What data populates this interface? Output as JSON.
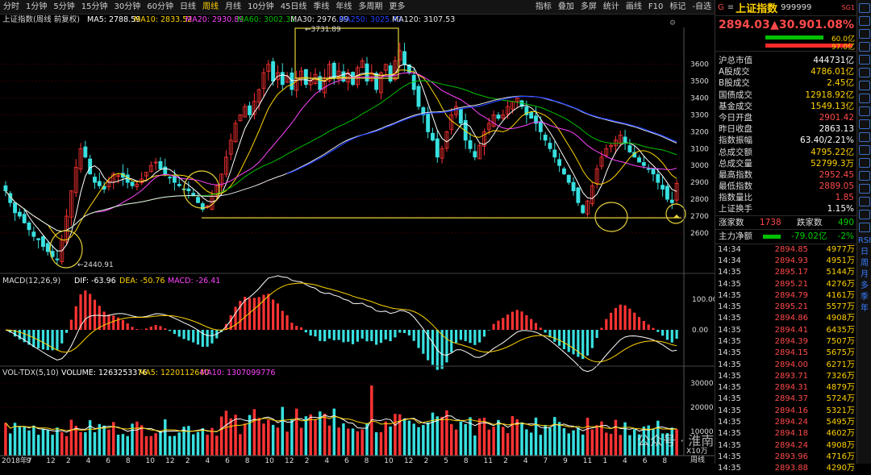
{
  "toolbar": {
    "periods": [
      "分时",
      "1分钟",
      "5分钟",
      "15分钟",
      "30分钟",
      "60分钟",
      "日线",
      "周线",
      "月线",
      "10分钟",
      "45日线",
      "季线",
      "年线",
      "多周期",
      "更多"
    ],
    "active_period": "周线",
    "right_tools": [
      "指标",
      "叠加",
      "多屏",
      "统计",
      "画线",
      "F10",
      "标记",
      "-自选"
    ]
  },
  "chart_header": {
    "name": "上证指数(周线 前复权)",
    "ma5": "MA5: 2788.59",
    "ma10": "MA10: 2833.52",
    "ma20": "MA20: 2930.89",
    "ma60": "MA60: 3002.31",
    "ma30": "MA30: 2976.99",
    "ma250": "MA250: 3025.43",
    "ma120": "MA120: 3107.53"
  },
  "colors": {
    "up": "#ff3333",
    "down": "#38e0e0",
    "ma5": "#ffffff",
    "ma10": "#ffd400",
    "ma20": "#ff44ff",
    "ma60": "#00c000",
    "ma120": "#e8e8e8",
    "ma250": "#2040ff",
    "annot": "#e6d23a",
    "grid": "#8a0000"
  },
  "chart_data": {
    "type": "candlestick",
    "price_axis": {
      "ticks": [
        3600,
        3500,
        3400,
        3300,
        3200,
        3100,
        3000,
        2900,
        2800,
        2700,
        2600
      ],
      "range": [
        2380,
        3780
      ]
    },
    "date_labels": [
      "2018年7",
      "9",
      "12",
      "2",
      "4",
      "6",
      "8",
      "10",
      "12",
      "2",
      "4",
      "6",
      "8",
      "10",
      "12",
      "2",
      "4",
      "6",
      "8",
      "10",
      "12",
      "2",
      "5",
      "8",
      "11",
      "2",
      "4",
      "7",
      "9",
      "11",
      "1",
      "4",
      "6",
      "8"
    ],
    "period_label": "周线",
    "high_label": "3731.89",
    "low_label": "2440.91",
    "support_level": 2690,
    "price_path": [
      2850,
      2780,
      2720,
      2700,
      2660,
      2620,
      2580,
      2560,
      2520,
      2490,
      2460,
      2441,
      2560,
      2700,
      2850,
      2990,
      3100,
      3050,
      2950,
      2900,
      2880,
      2860,
      2910,
      2950,
      2940,
      2930,
      2900,
      2880,
      2890,
      2920,
      2960,
      3000,
      3020,
      2980,
      2950,
      2930,
      2900,
      2880,
      2860,
      2850,
      2820,
      2780,
      2740,
      2760,
      2820,
      2880,
      2950,
      3050,
      3150,
      3250,
      3300,
      3350,
      3300,
      3380,
      3450,
      3550,
      3600,
      3500,
      3550,
      3480,
      3530,
      3450,
      3520,
      3560,
      3480,
      3500,
      3540,
      3450,
      3520,
      3600,
      3520,
      3560,
      3500,
      3550,
      3480,
      3580,
      3620,
      3500,
      3550,
      3450,
      3550,
      3600,
      3500,
      3620,
      3680,
      3600,
      3550,
      3450,
      3350,
      3300,
      3200,
      3150,
      3050,
      3100,
      3200,
      3300,
      3350,
      3250,
      3150,
      3100,
      3050,
      3120,
      3200,
      3250,
      3300,
      3280,
      3300,
      3350,
      3380,
      3400,
      3350,
      3300,
      3280,
      3250,
      3200,
      3150,
      3100,
      3050,
      3000,
      2950,
      2900,
      2850,
      2780,
      2720,
      2790,
      2880,
      2980,
      3050,
      3100,
      3120,
      3150,
      3180,
      3130,
      3080,
      3050,
      3020,
      3000,
      2980,
      2950,
      2900,
      2860,
      2800,
      2780,
      2894.03
    ],
    "macd": {
      "label": "MACD(12,26,9)",
      "dif": "DIF: -63.96",
      "dea": "DEA: -50.76",
      "macd": "MACD: -26.41",
      "ticks": [
        100.0,
        0.0
      ]
    },
    "volume": {
      "label": "VOL-TDX(5,10)",
      "volume": "VOLUME: 1263253376",
      "ma5": "MA5: 1220112640",
      "ma10": "MA10: 1307099776",
      "ticks": [
        30000,
        20000,
        10000
      ],
      "unit": "X10万"
    }
  },
  "quote": {
    "code_prefix": "G",
    "name": "上证指数",
    "code": "999999",
    "tag": "SG1",
    "price": "2894.03",
    "change": "▲30.90",
    "change_pct": "1.08%",
    "buy_amt": "60.0亿",
    "sell_amt": "97.0亿",
    "stats": [
      {
        "label": "沪总市值",
        "value": "444731亿",
        "color": "#ffffff"
      },
      {
        "label": "A股成交",
        "value": "4786.01亿",
        "color": "#ffd200"
      },
      {
        "label": "B股成交",
        "value": "2.45亿",
        "color": "#ffd200"
      },
      {
        "label": "国债成交",
        "value": "12918.92亿",
        "color": "#ffd200"
      },
      {
        "label": "基金成交",
        "value": "1549.13亿",
        "color": "#ffd200"
      },
      {
        "label": "今日开盘",
        "value": "2901.42",
        "color": "#ff4a4a"
      },
      {
        "label": "昨日收盘",
        "value": "2863.13",
        "color": "#ffffff"
      },
      {
        "label": "指数振幅",
        "value": "63.40/2.21%",
        "color": "#ffffff"
      },
      {
        "label": "总成交额",
        "value": "4795.22亿",
        "color": "#ffd200"
      },
      {
        "label": "总成交量",
        "value": "52799.3万",
        "color": "#ffd200"
      },
      {
        "label": "最高指数",
        "value": "2952.45",
        "color": "#ff4a4a"
      },
      {
        "label": "最低指数",
        "value": "2889.05",
        "color": "#ff4a4a"
      },
      {
        "label": "指数量比",
        "value": "1.85",
        "color": "#ff4a4a"
      },
      {
        "label": "上证换手",
        "value": "1.15%",
        "color": "#ffffff"
      }
    ],
    "rise_label": "涨家数",
    "rise_value": "1738",
    "fall_label": "跌家数",
    "fall_value": "490",
    "main_label": "主力净额",
    "main_value": "-79.02亿",
    "main_pct": "-2%"
  },
  "ticks": [
    {
      "time": "14:34",
      "price": "2894.85",
      "vol": "4977万"
    },
    {
      "time": "14:34",
      "price": "2894.93",
      "vol": "4951万"
    },
    {
      "time": "14:35",
      "price": "2895.17",
      "vol": "5144万"
    },
    {
      "time": "14:35",
      "price": "2895.21",
      "vol": "4276万"
    },
    {
      "time": "14:35",
      "price": "2894.79",
      "vol": "4161万"
    },
    {
      "time": "14:35",
      "price": "2895.21",
      "vol": "5577万"
    },
    {
      "time": "14:35",
      "price": "2894.86",
      "vol": "4908万"
    },
    {
      "time": "14:35",
      "price": "2894.41",
      "vol": "6435万"
    },
    {
      "time": "14:35",
      "price": "2894.39",
      "vol": "7507万"
    },
    {
      "time": "14:35",
      "price": "2894.15",
      "vol": "5675万"
    },
    {
      "time": "14:35",
      "price": "2894.00",
      "vol": "6271万"
    },
    {
      "time": "14:35",
      "price": "2893.71",
      "vol": "7326万"
    },
    {
      "time": "14:35",
      "price": "2894.31",
      "vol": "4879万"
    },
    {
      "time": "14:35",
      "price": "2894.37",
      "vol": "5724万"
    },
    {
      "time": "14:35",
      "price": "2894.16",
      "vol": "5321万"
    },
    {
      "time": "14:35",
      "price": "2894.24",
      "vol": "5495万"
    },
    {
      "time": "14:35",
      "price": "2894.18",
      "vol": "4602万"
    },
    {
      "time": "14:35",
      "price": "2894.24",
      "vol": "4908万"
    },
    {
      "time": "14:35",
      "price": "2893.96",
      "vol": "4716万"
    },
    {
      "time": "14:35",
      "price": "2893.88",
      "vol": "4290万"
    }
  ],
  "sidebar": {
    "labels": [
      "RSI",
      "日",
      "周",
      "月",
      "多",
      "季",
      "年"
    ]
  },
  "watermark": "公众号 · 淮南一"
}
